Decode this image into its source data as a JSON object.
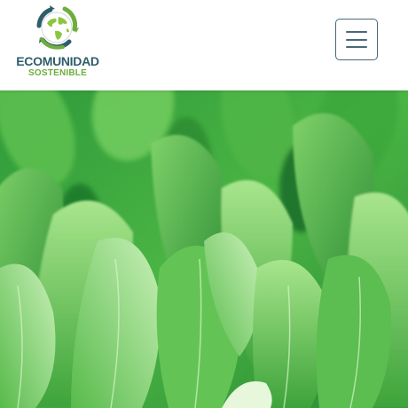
{
  "header": {
    "logo": {
      "title": "ECOMUNIDAD",
      "subtitle": "SOSTENIBLE",
      "icon": "globe-recycle-icon",
      "colors": {
        "primary": "#2e5d6b",
        "accent": "#6dae3c"
      }
    },
    "menu": {
      "icon": "hamburger-menu-icon",
      "border_color": "#4a6878"
    }
  },
  "hero": {
    "image": "green-seedling-leaves-photo",
    "colors": {
      "dominant": "#3fa83c",
      "highlight": "#c9f0b8",
      "shadow": "#1e6f2a"
    }
  }
}
